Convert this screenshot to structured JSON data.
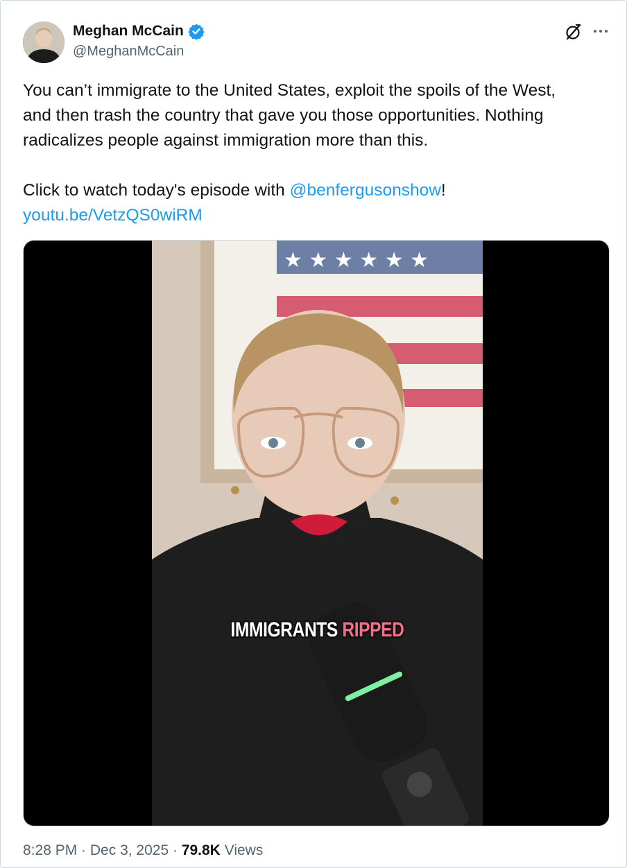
{
  "author": {
    "display_name": "Meghan McCain",
    "handle": "@MeghanMcCain",
    "verified": true,
    "verified_color": "#1d9bf0"
  },
  "tweet": {
    "text_line1": "You can’t immigrate to the United States, exploit the spoils of the West,",
    "text_line2": "and then trash the country that gave you those opportunities. Nothing",
    "text_line3": "radicalizes people against immigration more than this.",
    "cta_prefix": "Click to watch today's episode with ",
    "mention": "@benfergusonshow",
    "cta_suffix": "!",
    "link": "youtu.be/VetzQS0wiRM"
  },
  "video": {
    "caption_white": "IMMIGRANTS ",
    "caption_accent": "RIPPED",
    "caption_accent_color": "#f36d85",
    "background_color": "#000000"
  },
  "footer": {
    "time": "8:28 PM",
    "sep1": " · ",
    "date": "Dec 3, 2025",
    "sep2": " · ",
    "views_count": "79.8K",
    "views_label": " Views"
  },
  "icons": {
    "grok": "grok-icon",
    "more": "more-options-icon",
    "verified": "verified-badge-icon"
  },
  "colors": {
    "link": "#1d9bf0",
    "text": "#0f1419",
    "secondary": "#536471"
  }
}
